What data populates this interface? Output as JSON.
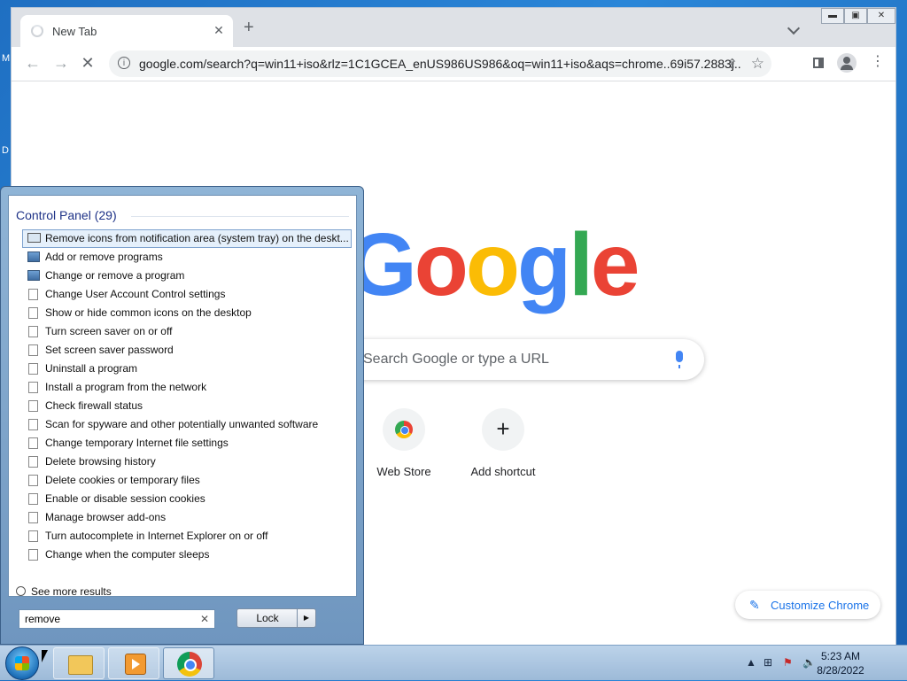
{
  "desktop": {
    "labels": [
      "M",
      "D"
    ]
  },
  "browser": {
    "tab_title": "New Tab",
    "url": "google.com/search?q=win11+iso&rlz=1C1GCEA_enUS986US986&oq=win11+iso&aqs=chrome..69i57.2883j...",
    "logo_text": "Google",
    "search_placeholder": "Search Google or type a URL",
    "shortcuts": [
      "Web Store",
      "Add shortcut"
    ],
    "customize_label": "Customize Chrome"
  },
  "start_menu": {
    "group_header": "Control Panel (29)",
    "items": [
      "Remove icons from notification area (system tray) on the deskt...",
      "Add or remove programs",
      "Change or remove a program",
      "Change User Account Control settings",
      "Show or hide common icons on the desktop",
      "Turn screen saver on or off",
      "Set screen saver password",
      "Uninstall a program",
      "Install a program from the network",
      "Check firewall status",
      "Scan for spyware and other potentially unwanted software",
      "Change temporary Internet file settings",
      "Delete browsing history",
      "Delete cookies or temporary files",
      "Enable or disable session cookies",
      "Manage browser add-ons",
      "Turn autocomplete in Internet Explorer on or off",
      "Change when the computer sleeps"
    ],
    "see_more": "See more results",
    "search_value": "remove",
    "lock_label": "Lock"
  },
  "taskbar": {
    "time": "5:23 AM",
    "date": "8/28/2022"
  }
}
